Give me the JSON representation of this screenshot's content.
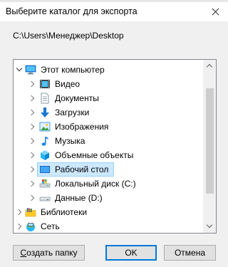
{
  "dialog": {
    "title": "Выберите каталог для экспорта",
    "path": "C:\\Users\\Менеджер\\Desktop"
  },
  "tree": {
    "items": [
      {
        "label": "Этот компьютер",
        "icon": "computer-icon",
        "expanded": true
      },
      {
        "label": "Видео",
        "icon": "video-folder-icon"
      },
      {
        "label": "Документы",
        "icon": "documents-folder-icon"
      },
      {
        "label": "Загрузки",
        "icon": "downloads-folder-icon"
      },
      {
        "label": "Изображения",
        "icon": "pictures-folder-icon"
      },
      {
        "label": "Музыка",
        "icon": "music-folder-icon"
      },
      {
        "label": "Объемные объекты",
        "icon": "3d-objects-folder-icon"
      },
      {
        "label": "Рабочий стол",
        "icon": "desktop-folder-icon",
        "selected": true
      },
      {
        "label": "Локальный диск (C:)",
        "icon": "local-disk-icon"
      },
      {
        "label": "Данные (D:)",
        "icon": "data-disk-icon"
      },
      {
        "label": "Библиотеки",
        "icon": "libraries-icon"
      },
      {
        "label": "Сеть",
        "icon": "network-icon"
      }
    ]
  },
  "buttons": {
    "make_folder_prefix": "",
    "make_folder_mnemonic": "С",
    "make_folder_rest": "оздать папку",
    "ok": "OK",
    "cancel": "Отмена"
  },
  "colors": {
    "selection_bg": "#cce8ff",
    "selection_border": "#99d1ff",
    "default_button_border": "#0078d7"
  }
}
